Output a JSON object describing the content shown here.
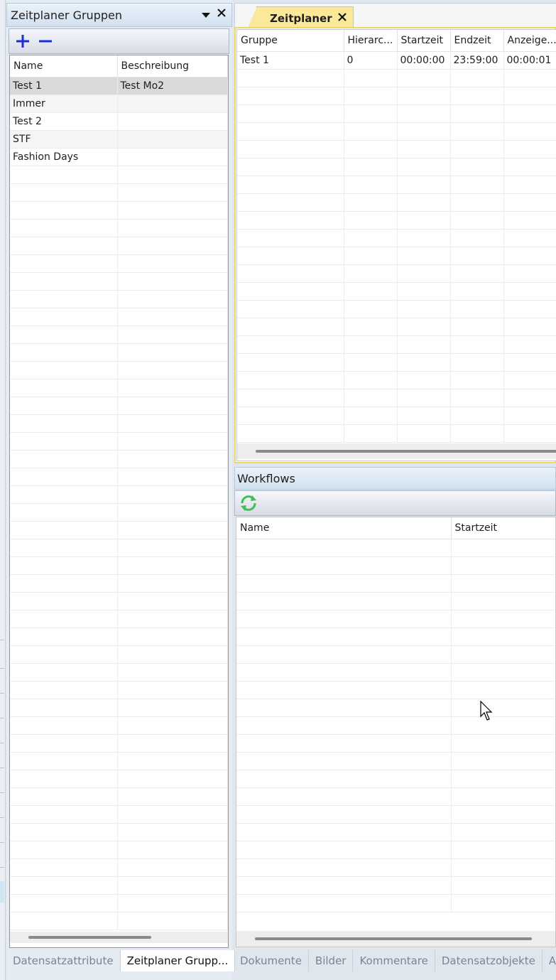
{
  "left_panel": {
    "title": "Zeitplaner Gruppen",
    "columns": [
      "Name",
      "Beschreibung"
    ],
    "rows": [
      [
        "Test 1",
        "Test Mo2"
      ],
      [
        "Immer",
        ""
      ],
      [
        "Test 2",
        ""
      ],
      [
        "STF",
        ""
      ],
      [
        "Fashion Days",
        ""
      ]
    ],
    "selected_row": 0
  },
  "left_bottom_tabs": [
    "Datensatzattribute",
    "Zeitplaner Grupp..."
  ],
  "zeitplaner": {
    "tab_label": "Zeitplaner",
    "columns": [
      "Gruppe",
      "Hierarc...",
      "Startzeit",
      "Endzeit",
      "Anzeige..."
    ],
    "rows": [
      [
        "Test 1",
        "0",
        "00:00:00",
        "23:59:00",
        "00:00:01"
      ]
    ]
  },
  "workflows": {
    "title": "Workflows",
    "columns": [
      "Name",
      "Startzeit"
    ],
    "rows": []
  },
  "right_bottom_tabs": [
    "Dokumente",
    "Bilder",
    "Kommentare",
    "Datensatzobjekte",
    "A"
  ],
  "colors": {
    "active_tab": "#fbe99b",
    "add_remove_icon": "#1a2fd8",
    "refresh_icon": "#3fbf5a"
  },
  "icons": [
    "plus-icon",
    "minus-icon",
    "dropdown-arrow-icon",
    "close-icon",
    "refresh-icon",
    "mouse-cursor-icon"
  ]
}
